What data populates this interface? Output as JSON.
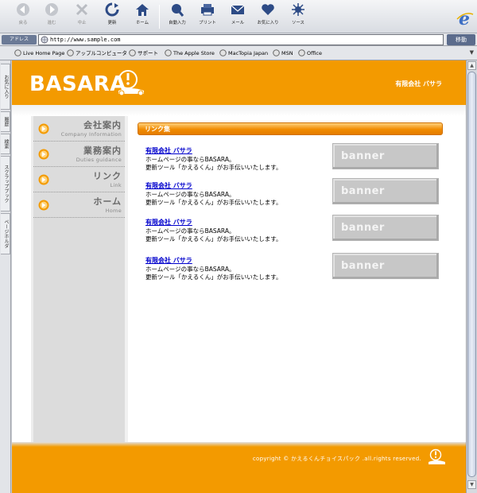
{
  "toolbar": {
    "back": "戻る",
    "forward": "進む",
    "stop": "中止",
    "refresh": "更新",
    "home": "ホーム",
    "autofill": "自動入力",
    "print": "プリント",
    "mail": "メール",
    "favorites": "お気に入り",
    "source": "ソース"
  },
  "address": {
    "label": "アドレス",
    "url": "http://www.sample.com",
    "go": "移動"
  },
  "links": [
    "Live Home Page",
    "アップルコンピュータ",
    "サポート",
    "The Apple Store",
    "MacTopia Japan",
    "MSN",
    "Office"
  ],
  "side_tabs": [
    "お気に入り",
    "履歴",
    "検索",
    "スクラップブック",
    "ページホルダ"
  ],
  "site": {
    "logo": "BASARA",
    "company": "有限会社 バサラ",
    "nav": [
      {
        "jp": "会社案内",
        "en": "Company Information"
      },
      {
        "jp": "業務案内",
        "en": "Duties guidance"
      },
      {
        "jp": "リンク",
        "en": "Link"
      },
      {
        "jp": "ホーム",
        "en": "Home"
      }
    ],
    "section_title": "リンク集",
    "entries": [
      {
        "name": "有限会社 バサラ",
        "line1": "ホームページの事ならBASARA。",
        "line2": "更新ツール「かえるくん」がお手伝いいたします。",
        "banner": "banner"
      },
      {
        "name": "有限会社 バサラ",
        "line1": "ホームページの事ならBASARA。",
        "line2": "更新ツール「かえるくん」がお手伝いいたします。",
        "banner": "banner"
      },
      {
        "name": "有限会社 バサラ",
        "line1": "ホームページの事ならBASARA。",
        "line2": "更新ツール「かえるくん」がお手伝いいたします。",
        "banner": "banner"
      },
      {
        "name": "有限会社 バサラ",
        "line1": "ホームページの事ならBASARA。",
        "line2": "更新ツール「かえるくん」がお手伝いいたします。",
        "banner": "banner"
      }
    ],
    "copyright": "copyright © かえるくんチョイスパック .all.rights reserved."
  },
  "colors": {
    "accent": "#f39a00",
    "link": "#0000cc"
  }
}
